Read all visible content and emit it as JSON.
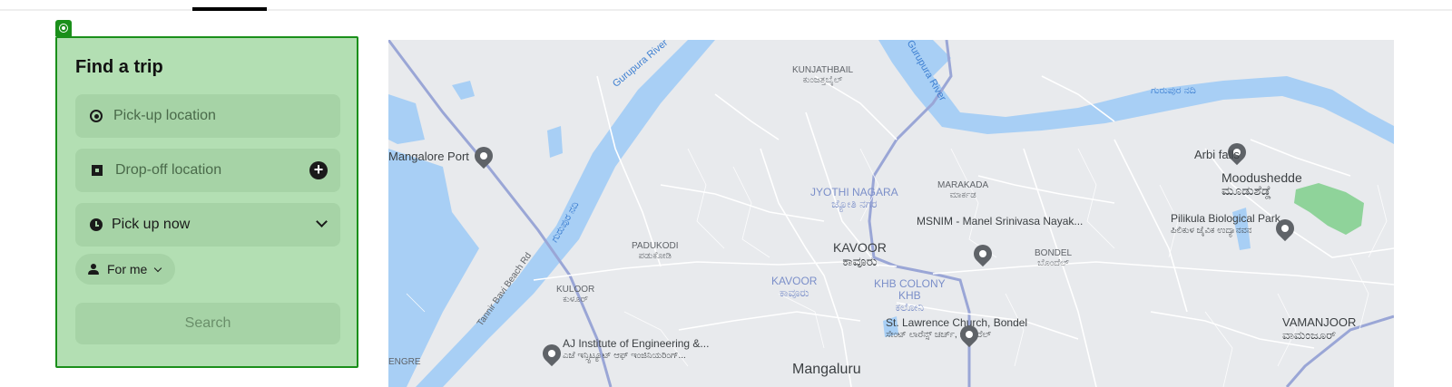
{
  "trip_form": {
    "title": "Find a trip",
    "pickup": {
      "placeholder": "Pick-up location",
      "icon": "pickup-dot-icon"
    },
    "dropoff": {
      "placeholder": "Drop-off location",
      "icon": "dropoff-square-icon",
      "add_icon": "plus-circle-icon"
    },
    "time": {
      "value": "Pick up now",
      "icon": "clock-icon"
    },
    "rider": {
      "value": "For me",
      "icon": "person-icon"
    },
    "search_label": "Search",
    "accent": "#1a8f1a"
  },
  "map": {
    "labels": {
      "gurupura_river_1": "Gurupura River",
      "gurupura_river_2": "Gurupura River",
      "gurupura_kn_1": "ಗುರುಪುರ ನದಿ",
      "gurupura_kn_2": "ಗುರುಪುರ ನದಿ",
      "kunjathbail": "KUNJATHBAIL",
      "kunjathbail_kn": "ಕುಂಜತ್ತಬೈಲ್",
      "mangalore_port": "Mangalore Port",
      "jyothi_nagara": "JYOTHI NAGARA",
      "jyothi_nagara_kn": "ಜ್ಯೋತಿ ನಗರ",
      "marakada": "MARAKADA",
      "marakada_kn": "ಮಾರ್ಕಡ",
      "arbi_falls": "Arbi falls",
      "moodushedde": "Moodushedde",
      "moodushedde_kn": "ಮೂಡುಶೆಡ್ಡೆ",
      "pilikula": "Pilikula Biological Park",
      "pilikula_kn": "ಪಿಲಿಕುಳ ಜೈವಿಕ ಉದ್ಯಾನವನ",
      "msnim": "MSNIM - Manel Srinivasa Nayak...",
      "kavoor": "KAVOOR",
      "kavoor_kn": "ಕಾವೂರು",
      "kavoor2": "KAVOOR",
      "kavoor2_kn": "ಕಾವೂರು",
      "padukodi": "PADUKODI",
      "padukodi_kn": "ಪಡುಕೋಡಿ",
      "bondel": "BONDEL",
      "bondel_kn": "ಬೊಂದೆಲ್",
      "khb_colony": "KHB COLONY",
      "khb": "KHB",
      "khb_kn": "ಕಲೋನಿ",
      "kuloor": "KULOOR",
      "kuloor_kn": "ಕುಳೂರ್",
      "tannir_bavi": "Tannir Bavi Beach Rd",
      "st_lawrence": "St. Lawrence Church, Bondel",
      "st_lawrence_kn": "ಸೇಂಟ್ ಲಾರೆನ್ಸ್ ಚರ್ಚ್, ಬೊಂದೆಲ್",
      "vamanjoor": "VAMANJOOR",
      "vamanjoor_kn": "ವಾಮಂಜೂರ್",
      "aj_institute": "AJ Institute of Engineering &...",
      "aj_institute_kn": "ಎಜೆ ಇನ್ಸ್ಟಿಟ್ಯೂಟ್ ಆಫ್ ಇಂಜಿನಿಯರಿಂಗ್...",
      "engre": "ENGRE",
      "mangaluru": "Mangaluru"
    },
    "colors": {
      "land": "#e8eaed",
      "water": "#a8cff5",
      "road": "#ffffff",
      "highway": "#9aa6d6",
      "park": "#8fd39a"
    }
  }
}
